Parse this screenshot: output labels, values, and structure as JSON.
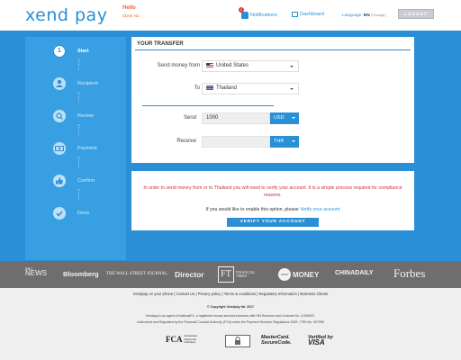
{
  "header": {
    "logo": "xend pay",
    "hello": "Hello",
    "client_no": "Client No:",
    "notifications_label": "Notifications",
    "notification_count": "1",
    "dashboard_label": "Dashboard",
    "language_prefix": "Language:",
    "language_code": "EN",
    "change_label": "(Change)",
    "logout_label": "LOGOUT"
  },
  "steps": [
    {
      "marker": "1",
      "label": "Start",
      "icon": "number-1",
      "active": true
    },
    {
      "marker": "",
      "label": "Recipient",
      "icon": "user-icon",
      "active": false
    },
    {
      "marker": "",
      "label": "Review",
      "icon": "search-icon",
      "active": false
    },
    {
      "marker": "",
      "label": "Payment",
      "icon": "money-icon",
      "active": false
    },
    {
      "marker": "",
      "label": "Confirm",
      "icon": "thumbs-up-icon",
      "active": false
    },
    {
      "marker": "",
      "label": "Done",
      "icon": "check-icon",
      "active": false
    }
  ],
  "transfer": {
    "title": "YOUR TRANSFER",
    "from_label": "Send money from",
    "from_value": "United States",
    "to_label": "To",
    "to_value": "Thailand",
    "send_label": "Send",
    "send_amount": "1000",
    "send_currency": "USD",
    "receive_label": "Receive",
    "receive_amount": "",
    "receive_currency": "THB"
  },
  "verify": {
    "warning": "In order to send money from or to Thailand you will need to verify your account. It is a simple process required for compliance reasons.",
    "enable_text": "If you would like to enable this option, please",
    "enable_link": "Verify your account",
    "button_label": "VERIFY YOUR ACCOUNT"
  },
  "press": {
    "bbc_top": "BBC",
    "bbc_bottom": "NEWS",
    "bloomberg": "Bloomberg",
    "wsj": "THE WALL STREET JOURNAL.",
    "director": "Director",
    "ft_box": "FT",
    "ft_line1": "FINANCIAL",
    "ft_line2": "TIMES",
    "ideal": "ideal",
    "money": "MONEY",
    "chinadaily": "CHINADAILY",
    "forbes": "Forbes"
  },
  "footer": {
    "links": [
      "Xendpay on your phone",
      "Contact Us",
      "Privacy policy",
      "Terms & conditions",
      "Regulatory Information",
      "Business Clients"
    ],
    "copyright": "© Copyright Xendpay ltd. 2017",
    "legal_line1": "Xendpay is an agent of NationalFX, a registered money services business with HM Revenue and Customs No. 12269937.",
    "legal_line2": "Authorised and Regulated by the Financial Conduct Authority (FCA) under the Payment Services Regulations 2009 - FRN No. 507958",
    "fca": "FCA",
    "fca_sub1": "Authorised",
    "fca_sub2": "Payments",
    "fca_sub3": "Institution",
    "mc_line1": "MasterCard.",
    "mc_line2": "SecureCode.",
    "visa_line1": "Verified by",
    "visa_line2": "VISA"
  },
  "colors": {
    "brand_blue": "#2a8fd6",
    "step_panel": "#38a0e2",
    "warning_red": "#d0312d",
    "accent_orange": "#e8632b",
    "press_bar": "#6e6e6e"
  }
}
